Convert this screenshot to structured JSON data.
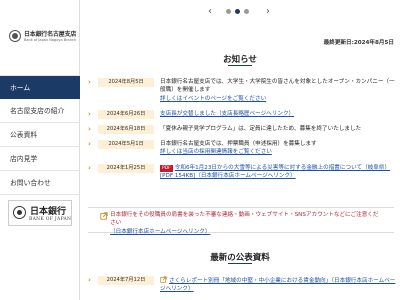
{
  "sidebar": {
    "logo_jp": "日本銀行名古屋支店",
    "logo_en": "Bank of Japan Nagoya Branch",
    "nav": [
      {
        "label": "ホーム",
        "active": true
      },
      {
        "label": "名古屋支店の紹介",
        "active": false
      },
      {
        "label": "公表資料",
        "active": false
      },
      {
        "label": "店内見学",
        "active": false
      },
      {
        "label": "お問い合わせ",
        "active": false
      }
    ],
    "boj_logo_jp": "日本銀行",
    "boj_logo_en": "BANK OF JAPAN"
  },
  "slider": {
    "prev": "‹",
    "next": "›",
    "dot_count": 3,
    "active_dot": 1
  },
  "updated": "最終更新日:2024年8月5日",
  "notices_title": "お知らせ",
  "news": [
    {
      "date": "2024年8月5日",
      "text": "日本銀行名古屋支店では、大学生・大学院生の皆さんを対象としたオープン・カンパニー（一般職）を開催します",
      "link": "詳しくはイベントのページをご覧ください"
    },
    {
      "date": "2024年6月26日",
      "text": "",
      "link": "支店長が交替しました（支店長略歴ページへリンク）"
    },
    {
      "date": "2024年6月18日",
      "text": "「夏休み親子見学プログラム」は、定員に達したため、募集を終了いたしました",
      "link": ""
    },
    {
      "date": "2024年5月1日",
      "text": "日本銀行名古屋支店では、押票職員（申述採用）を募集します",
      "link": "詳しくは当店の採用関連情報をご覧ください"
    },
    {
      "date": "2024年1月25日",
      "badge": "PDF",
      "text": "",
      "link": "令和6年1月23日からの大雪等による災害等に対する金融上の措置について（岐阜県）[PDF 154KB]（日本銀行本店ホームページへリンク）"
    }
  ],
  "notice": {
    "text": "日本銀行をその役職員の肩書を装った不審な連絡・動画・ウェブサイト・SNSアカウントなどにご注意ください",
    "link": "（日本銀行本店ホームページへリンク）"
  },
  "publications_title": "最新の公表資料",
  "publications": [
    {
      "date": "2024年7月12日",
      "link": "さくらレポート別冊「地域の中堅・中小企業における賃金動向」（日本銀行本店ホームページへリンク）"
    }
  ],
  "colors": {
    "nav_active": "#1c3a66",
    "date_badge": "#fdf0d7",
    "link": "#1d50a8",
    "accent": "#c48a1b",
    "notice_red": "#b0263a"
  }
}
